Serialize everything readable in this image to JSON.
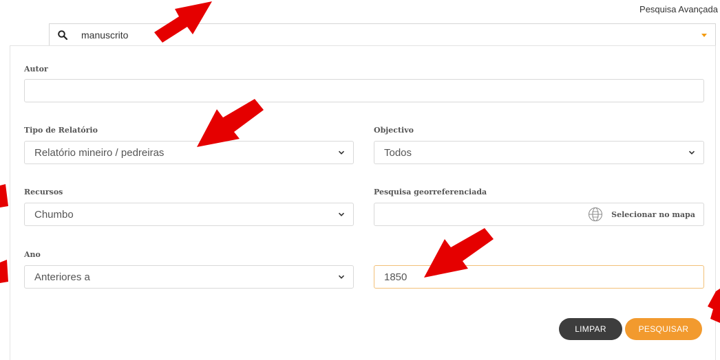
{
  "header": {
    "advanced_search_label": "Pesquisa Avançada"
  },
  "search": {
    "value": "manuscrito"
  },
  "form": {
    "author_label": "Autor",
    "author_value": "",
    "report_type_label": "Tipo de Relatório",
    "report_type_value": "Relatório mineiro / pedreiras",
    "objective_label": "Objectivo",
    "objective_value": "Todos",
    "resources_label": "Recursos",
    "resources_value": "Chumbo",
    "geo_label": "Pesquisa georreferenciada",
    "geo_value": "",
    "geo_button_label": "Selecionar no mapa",
    "year_label": "Ano",
    "year_mode_value": "Anteriores a",
    "year_value": "1850"
  },
  "actions": {
    "clear_label": "LIMPAR",
    "search_label": "PESQUISAR"
  },
  "icons": {
    "search": "search-icon",
    "dropdown": "caret-down-icon",
    "select": "chevron-down-icon",
    "map": "globe-icon",
    "annotation": "red-arrow-icon"
  },
  "colors": {
    "accent": "#f29a2e",
    "dark_button": "#3d3d3d",
    "annotation_arrow": "#e50000"
  }
}
